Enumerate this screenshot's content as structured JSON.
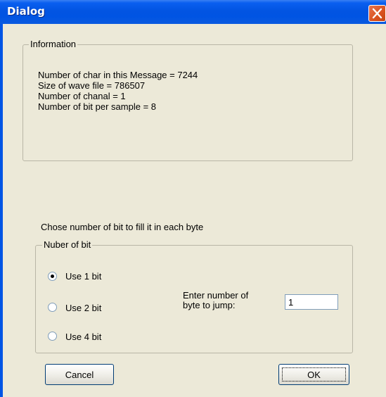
{
  "window": {
    "title": "Dialog"
  },
  "info": {
    "legend": "Information",
    "lines": [
      "Number of char in this Message = 7244",
      "Size of wave file = 786507",
      "Number of chanal = 1",
      "Number of bit per sample = 8"
    ]
  },
  "prompt": "Chose number of bit to fill it in each byte",
  "bits": {
    "legend": "Nuber of bit",
    "options": [
      {
        "label": "Use 1 bit",
        "checked": true
      },
      {
        "label": "Use 2 bit",
        "checked": false
      },
      {
        "label": "Use 4 bit",
        "checked": false
      }
    ],
    "jump_label": "Enter number of byte to jump:",
    "jump_value": "1"
  },
  "buttons": {
    "cancel": "Cancel",
    "ok": "OK"
  },
  "icons": {
    "close": "close-icon"
  },
  "colors": {
    "titlebar": "#0054e3",
    "close": "#d9521f",
    "client": "#ece9d8"
  }
}
